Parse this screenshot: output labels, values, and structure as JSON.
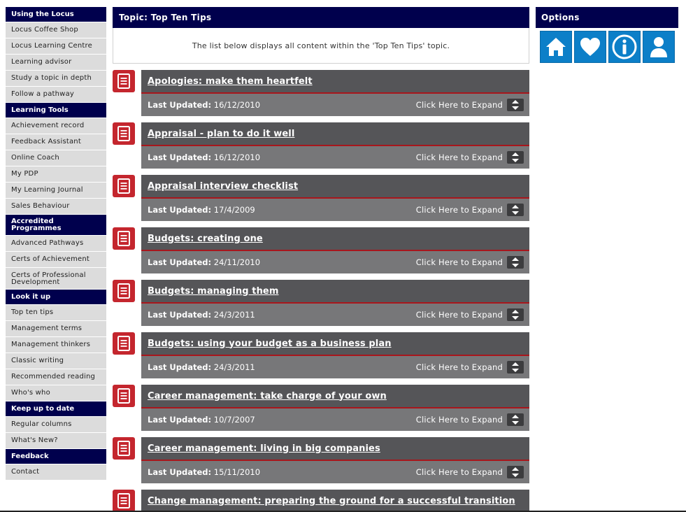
{
  "sidebar": {
    "groups": [
      {
        "heading": "Using the Locus",
        "items": [
          "Locus Coffee Shop",
          "Locus Learning Centre",
          "Learning advisor",
          "Study a topic in depth",
          "Follow a pathway"
        ]
      },
      {
        "heading": "Learning Tools",
        "items": [
          "Achievement record",
          "Feedback Assistant",
          "Online Coach",
          "My PDP",
          "My Learning Journal",
          "Sales Behaviour"
        ]
      },
      {
        "heading": "Accredited Programmes",
        "items": [
          "Advanced Pathways",
          "Certs of Achievement",
          "Certs of Professional Development"
        ]
      },
      {
        "heading": "Look it up",
        "items": [
          "Top ten tips",
          "Management terms",
          "Management thinkers",
          "Classic writing",
          "Recommended reading",
          "Who's who"
        ]
      },
      {
        "heading": "Keep up to date",
        "items": [
          "Regular columns",
          "What's New?"
        ]
      },
      {
        "heading": "Feedback",
        "items": [
          "Contact"
        ]
      }
    ]
  },
  "main": {
    "topic_title": "Topic: Top Ten Tips",
    "description": "The list below displays all content within the 'Top Ten Tips' topic.",
    "updated_label": "Last Updated:",
    "expand_label": "Click Here to Expand",
    "entries": [
      {
        "title": "Apologies: make them heartfelt",
        "date": "16/12/2010"
      },
      {
        "title": "Appraisal - plan to do it well",
        "date": "16/12/2010"
      },
      {
        "title": "Appraisal interview checklist",
        "date": "17/4/2009"
      },
      {
        "title": "Budgets: creating one",
        "date": "24/11/2010"
      },
      {
        "title": "Budgets: managing them",
        "date": "24/3/2011"
      },
      {
        "title": "Budgets: using your budget as a business plan",
        "date": "24/3/2011"
      },
      {
        "title": "Career management: take charge of your own",
        "date": "10/7/2007"
      },
      {
        "title": "Career management: living in big companies",
        "date": "15/11/2010"
      },
      {
        "title": "Change management: preparing the ground for a successful transition",
        "date": ""
      }
    ]
  },
  "options": {
    "heading": "Options",
    "icons": [
      "home-icon",
      "heart-icon",
      "info-icon",
      "user-icon"
    ]
  },
  "colors": {
    "nav_heading_bg": "#00004d",
    "nav_item_bg": "#dcdcdc",
    "entry_title_bg": "#555558",
    "entry_meta_bg": "#777779",
    "entry_accent": "#a8161c",
    "doc_icon_bg": "#c4262e",
    "option_button_bg": "#0c7fc8"
  }
}
